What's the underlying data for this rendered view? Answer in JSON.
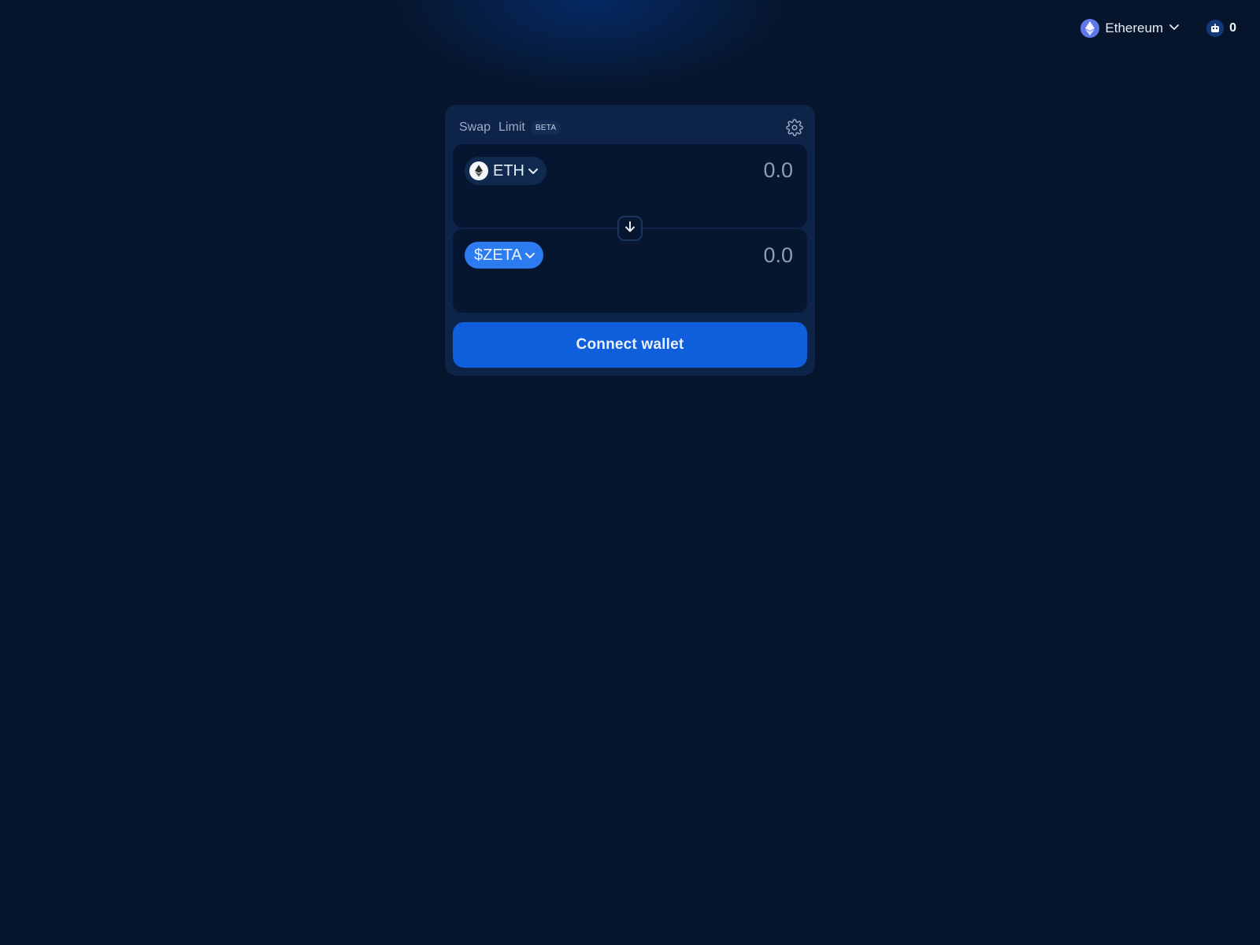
{
  "topbar": {
    "network": {
      "label": "Ethereum",
      "icon": "ethereum-icon"
    },
    "balance": {
      "value": "0",
      "icon": "robot-avatar-icon"
    }
  },
  "swap_card": {
    "tabs": [
      {
        "label": "Swap"
      },
      {
        "label": "Limit",
        "badge": "BETA"
      }
    ],
    "settings_icon": "gear-icon",
    "from": {
      "token": "ETH",
      "token_icon": "ethereum-icon",
      "amount_placeholder": "0.0"
    },
    "switch_icon": "arrow-down-icon",
    "to": {
      "token": "$ZETA",
      "amount_placeholder": "0.0"
    },
    "connect_label": "Connect wallet"
  },
  "colors": {
    "background": "#06152b",
    "card": "#0d2348",
    "panel": "#061630",
    "accent": "#0f5edb",
    "zeta_button": "#2c7bf0"
  }
}
